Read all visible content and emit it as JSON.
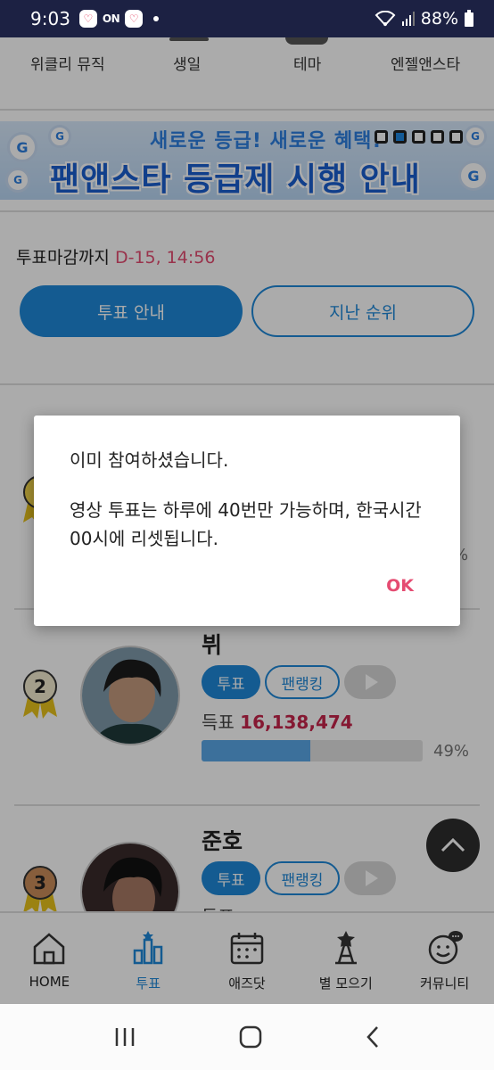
{
  "status_bar": {
    "time": "9:03",
    "on_label": "ON",
    "battery": "88%"
  },
  "top_categories": [
    "위클리 뮤직",
    "생일",
    "테마",
    "엔젤앤스타"
  ],
  "banner": {
    "line1": "새로운 등급! 새로운 혜택!",
    "line2": "팬앤스타 등급제 시행 안내",
    "badge": "G"
  },
  "vote_section": {
    "deadline_label": "투표마감까지",
    "deadline_value": "D-15, 14:56",
    "guide_button": "투표 안내",
    "past_rank_button": "지난 순위"
  },
  "rankings": [
    {
      "rank": "2",
      "name": "뷔",
      "vote_label": "투표",
      "fanrank_label": "팬랭킹",
      "votes_label": "득표",
      "votes": "16,138,474",
      "percent": "49%",
      "fill": 0.49
    },
    {
      "rank": "3",
      "name": "준호",
      "vote_label": "투표",
      "fanrank_label": "팬랭킹",
      "votes_label": "득표",
      "votes": ""
    }
  ],
  "first_rank_partial": {
    "percent": "%"
  },
  "dialog": {
    "message1": "이미 참여하셨습니다.",
    "message2": "영상 투표는 하루에 40번만 가능하며, 한국시간 00시에 리셋됩니다.",
    "ok": "OK"
  },
  "bottom_nav": [
    {
      "label": "HOME",
      "icon": "home-icon"
    },
    {
      "label": "투표",
      "icon": "vote-chart-icon",
      "active": true
    },
    {
      "label": "애즈닷",
      "icon": "calendar-icon"
    },
    {
      "label": "별 모으기",
      "icon": "star-tower-icon"
    },
    {
      "label": "커뮤니티",
      "icon": "smiley-chat-icon"
    }
  ],
  "colors": {
    "accent": "#1f88d8",
    "highlight": "#e54c72",
    "statusbar": "#1c2143"
  }
}
